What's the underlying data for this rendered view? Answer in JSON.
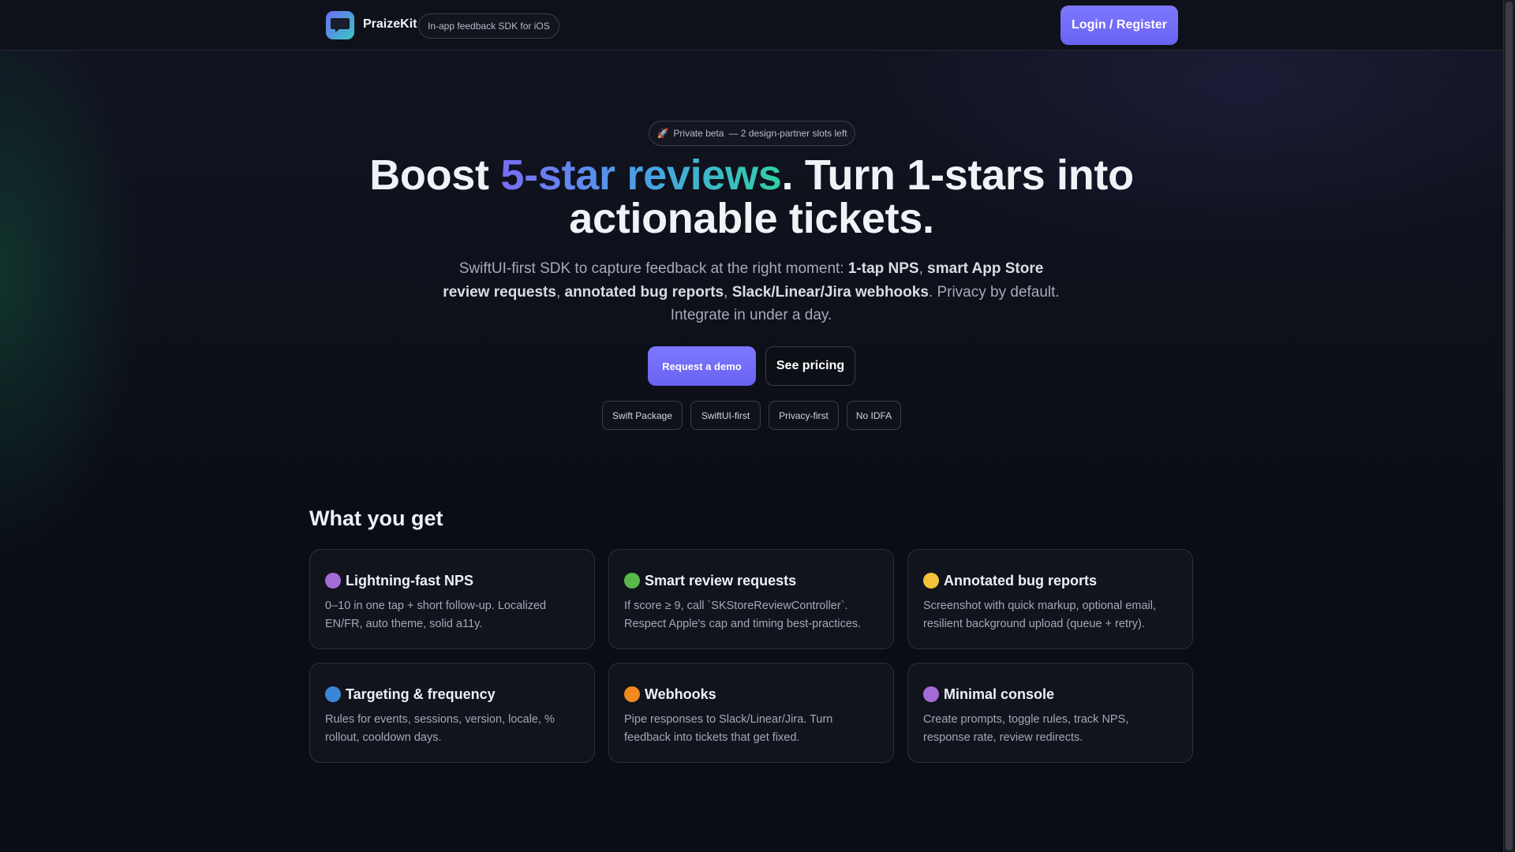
{
  "header": {
    "brand": "PraizeKit",
    "tagline": "In-app feedback SDK for iOS",
    "login_label": "Login / Register",
    "logo_icon": "chat-bubble-icon"
  },
  "hero": {
    "beta_badge_emoji": "🚀",
    "beta_badge_label": "Private beta",
    "beta_badge_note": "— 2 design-partner slots left",
    "title_prefix": "Boost ",
    "title_highlight": "5-star reviews",
    "title_suffix": ". Turn 1-stars into actionable tickets.",
    "subtitle": {
      "p1": "SwiftUI-first SDK to capture feedback at the right moment: ",
      "b1": "1-tap NPS",
      "p2": ", ",
      "b2": "smart App Store review requests",
      "p3": ", ",
      "b3": "annotated bug reports",
      "p4": ", ",
      "b4": "Slack/Linear/Jira webhooks",
      "p5": ". Privacy by default. Integrate in under a day."
    },
    "primary_cta": "Request a demo",
    "secondary_cta": "See pricing",
    "chips": [
      "Swift Package",
      "SwiftUI-first",
      "Privacy-first",
      "No IDFA"
    ]
  },
  "features": {
    "title": "What you get",
    "items": [
      {
        "title": "Lightning-fast NPS",
        "desc": "0–10 in one tap + short follow-up. Localized EN/FR, auto theme, solid a11y.",
        "color": "#a46ad8"
      },
      {
        "title": "Smart review requests",
        "desc": "If score ≥ 9, call `SKStoreReviewController`. Respect Apple's cap and timing best-practices.",
        "color": "#58b84c"
      },
      {
        "title": "Annotated bug reports",
        "desc": "Screenshot with quick markup, optional email, resilient background upload (queue + retry).",
        "color": "#f3c23a"
      },
      {
        "title": "Targeting & frequency",
        "desc": "Rules for events, sessions, version, locale, % rollout, cooldown days.",
        "color": "#3a86d6"
      },
      {
        "title": "Webhooks",
        "desc": "Pipe responses to Slack/Linear/Jira. Turn feedback into tickets that get fixed.",
        "color": "#f08a1c"
      },
      {
        "title": "Minimal console",
        "desc": "Create prompts, toggle rules, track NPS, response rate, review redirects.",
        "color": "#a46ad8"
      }
    ]
  }
}
